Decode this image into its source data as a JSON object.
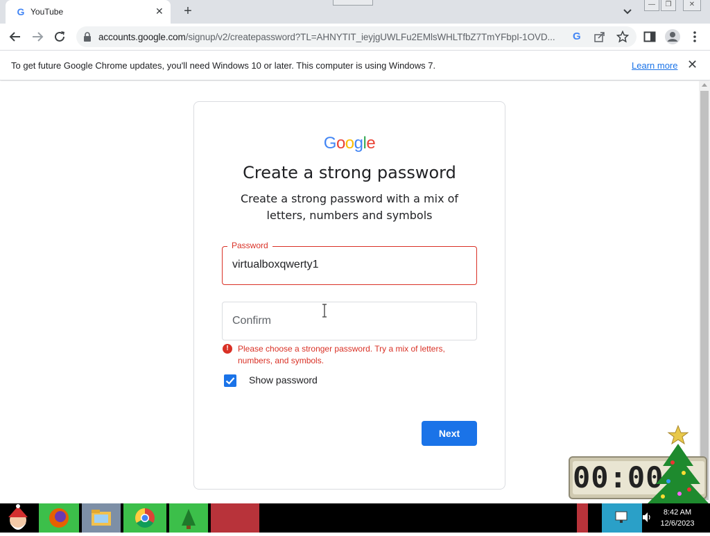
{
  "browser": {
    "tab_title": "YouTube",
    "url_host": "accounts.google.com",
    "url_path": "/signup/v2/createpassword?TL=AHNYTIT_ieyjgUWLFu2EMlsWHLTfbZ7TmYFbpI-1OVD...",
    "new_tab_label": "+"
  },
  "infobar": {
    "message": "To get future Google Chrome updates, you'll need Windows 10 or later. This computer is using Windows 7.",
    "link": "Learn more"
  },
  "signup": {
    "logo_letters": [
      "G",
      "o",
      "o",
      "g",
      "l",
      "e"
    ],
    "logo_colors": [
      "#4285f4",
      "#ea4335",
      "#fbbc05",
      "#4285f4",
      "#34a853",
      "#ea4335"
    ],
    "heading": "Create a strong password",
    "subheading": "Create a strong password with a mix of letters, numbers and symbols",
    "password_label": "Password",
    "password_value": "virtualboxqwerty1",
    "confirm_placeholder": "Confirm",
    "error_text": "Please choose a stronger password. Try a mix of letters, numbers, and symbols.",
    "show_password_label": "Show password",
    "show_password_checked": true,
    "next_label": "Next",
    "error_color": "#d93025",
    "accent_color": "#1a73e8"
  },
  "desktop": {
    "clock_display": "00:00"
  },
  "taskbar": {
    "time": "8:42 AM",
    "date": "12/6/2023"
  }
}
